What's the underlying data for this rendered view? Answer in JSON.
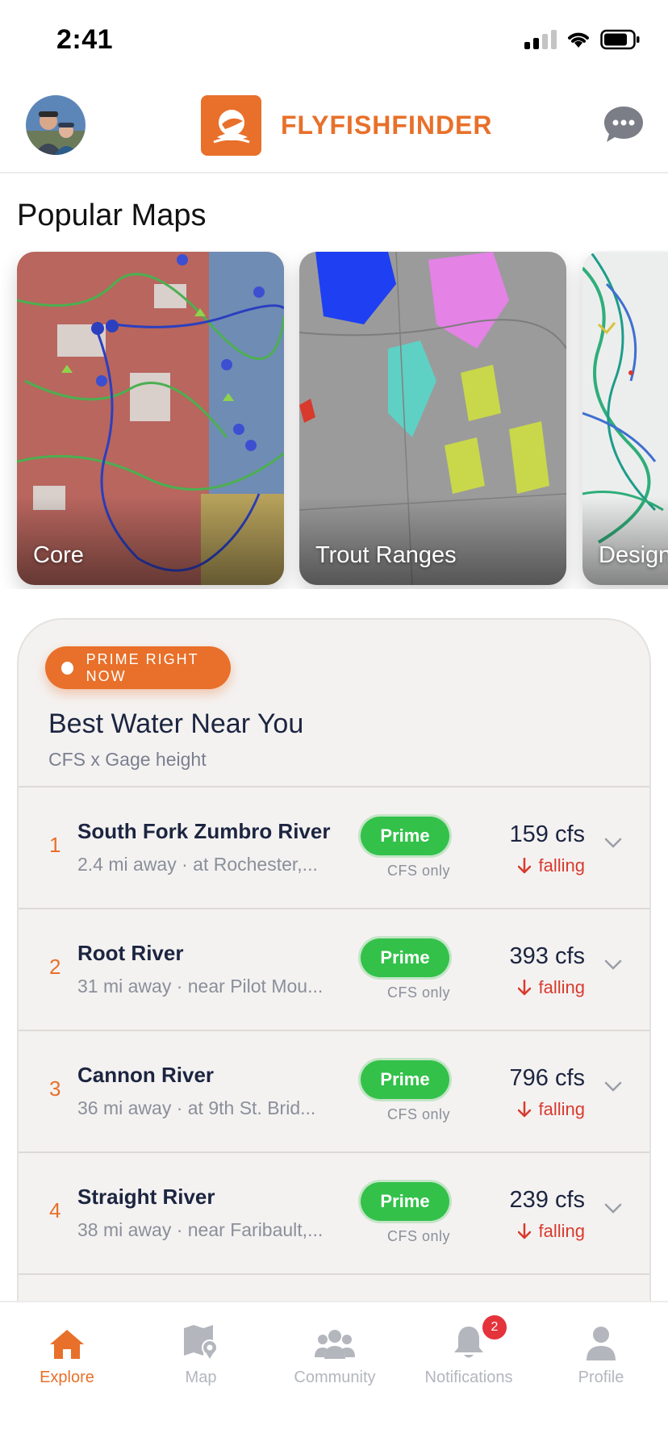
{
  "status_bar": {
    "time": "2:41"
  },
  "header": {
    "brand_name": "FLYFISHFINDER"
  },
  "popular_maps": {
    "title": "Popular Maps",
    "cards": [
      {
        "label": "Core"
      },
      {
        "label": "Trout Ranges"
      },
      {
        "label": "Design"
      }
    ]
  },
  "best_water": {
    "badge": "PRIME RIGHT NOW",
    "title": "Best Water Near You",
    "subtitle": "CFS x Gage height",
    "rows": [
      {
        "rank": "1",
        "name": "South Fork Zumbro River",
        "meta": "2.4 mi away · at Rochester,...",
        "status": "Prime",
        "basis": "CFS only",
        "flow": "159 cfs",
        "trend": "falling"
      },
      {
        "rank": "2",
        "name": "Root River",
        "meta": "31 mi away · near Pilot Mou...",
        "status": "Prime",
        "basis": "CFS only",
        "flow": "393 cfs",
        "trend": "falling"
      },
      {
        "rank": "3",
        "name": "Cannon River",
        "meta": "36 mi away · at 9th St. Brid...",
        "status": "Prime",
        "basis": "CFS only",
        "flow": "796 cfs",
        "trend": "falling"
      },
      {
        "rank": "4",
        "name": "Straight River",
        "meta": "38 mi away · near Faribault,...",
        "status": "Prime",
        "basis": "CFS only",
        "flow": "239 cfs",
        "trend": "falling"
      }
    ]
  },
  "tab_bar": {
    "tabs": [
      {
        "label": "Explore",
        "active": true
      },
      {
        "label": "Map"
      },
      {
        "label": "Community"
      },
      {
        "label": "Notifications",
        "badge": "2"
      },
      {
        "label": "Profile"
      }
    ]
  },
  "colors": {
    "accent": "#e8702a",
    "prime": "#33c14a",
    "falling": "#d83a2e"
  }
}
